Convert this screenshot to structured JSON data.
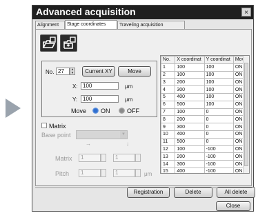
{
  "window": {
    "title": "Advanced acquisition",
    "close_glyph": "×"
  },
  "tabs": [
    {
      "label": "Alignment",
      "active": false
    },
    {
      "label": "Stage coordinates",
      "active": true
    },
    {
      "label": "Traveling acquisition",
      "active": false
    }
  ],
  "toolbar": {
    "open_icon": "folder-open-icon",
    "save_icon": "folder-save-icon"
  },
  "position_box": {
    "no_label": "No.",
    "no_value": "27",
    "current_xy_label": "Current XY",
    "move_label": "Move",
    "x_label": "X:",
    "x_value": "100",
    "y_label": "Y:",
    "y_value": "100",
    "unit": "μm",
    "move_radio_label": "Move",
    "on_label": "ON",
    "off_label": "OFF"
  },
  "matrix": {
    "checkbox_label": "Matrix",
    "base_point_label": "Base point",
    "arrow_h": "→",
    "arrow_v": "↓",
    "matrix_label": "Matrix",
    "matrix_x": "1",
    "matrix_y": "1",
    "pitch_label": "Pitch",
    "pitch_x": "1",
    "pitch_y": "1",
    "unit": "μm"
  },
  "table": {
    "headers": [
      "No.",
      "X coordinat",
      "Y coordinat",
      "Move"
    ],
    "rows": [
      [
        "1",
        "100",
        "100",
        "ON"
      ],
      [
        "2",
        "100",
        "100",
        "ON"
      ],
      [
        "3",
        "200",
        "100",
        "ON"
      ],
      [
        "4",
        "300",
        "100",
        "ON"
      ],
      [
        "5",
        "400",
        "100",
        "ON"
      ],
      [
        "6",
        "500",
        "100",
        "ON"
      ],
      [
        "7",
        "100",
        "0",
        "ON"
      ],
      [
        "8",
        "200",
        "0",
        "ON"
      ],
      [
        "9",
        "300",
        "0",
        "ON"
      ],
      [
        "10",
        "400",
        "0",
        "ON"
      ],
      [
        "11",
        "500",
        "0",
        "ON"
      ],
      [
        "12",
        "100",
        "-100",
        "ON"
      ],
      [
        "13",
        "200",
        "-100",
        "ON"
      ],
      [
        "14",
        "300",
        "-100",
        "ON"
      ],
      [
        "15",
        "400",
        "-100",
        "ON"
      ]
    ]
  },
  "actions": {
    "registration": "Registration",
    "delete": "Delete",
    "all_delete": "All delete",
    "close": "Close"
  },
  "colors": {
    "titlebar": "#1f1f1f",
    "radio_on": "#2f6fd0",
    "arrow": "#9aa3ad"
  }
}
